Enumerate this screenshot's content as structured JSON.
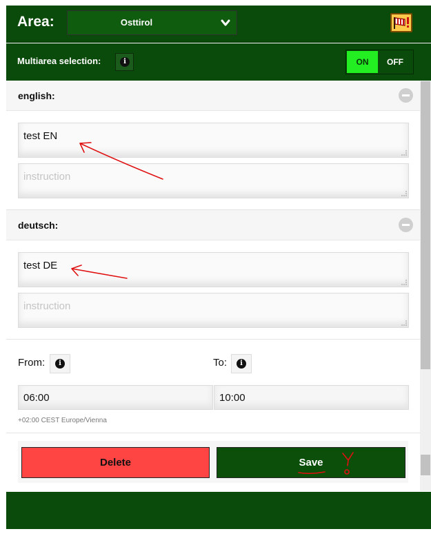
{
  "header": {
    "area_label": "Area:",
    "area_value": "Osttirol",
    "icons": {
      "chevron": "chevron-down-icon",
      "flag": "windsock-warning-icon"
    }
  },
  "multiarea": {
    "label": "Multiarea selection:",
    "on_label": "ON",
    "off_label": "OFF",
    "active": "ON"
  },
  "languages": [
    {
      "title": "english:",
      "text_value": "test EN",
      "instruction_placeholder": "instruction"
    },
    {
      "title": "deutsch:",
      "text_value": "test DE",
      "instruction_placeholder": "instruction"
    }
  ],
  "time": {
    "from_label": "From:",
    "to_label": "To:",
    "from_value": "06:00",
    "to_value": "10:00",
    "timezone": "+02:00 CEST Europe/Vienna"
  },
  "actions": {
    "delete_label": "Delete",
    "save_label": "Save"
  },
  "colors": {
    "brand_green": "#0a4a0a",
    "toggle_on": "#22ee22",
    "delete_red": "#ff4444",
    "save_green": "#0b4f0b",
    "annotation_red": "#e01010"
  }
}
